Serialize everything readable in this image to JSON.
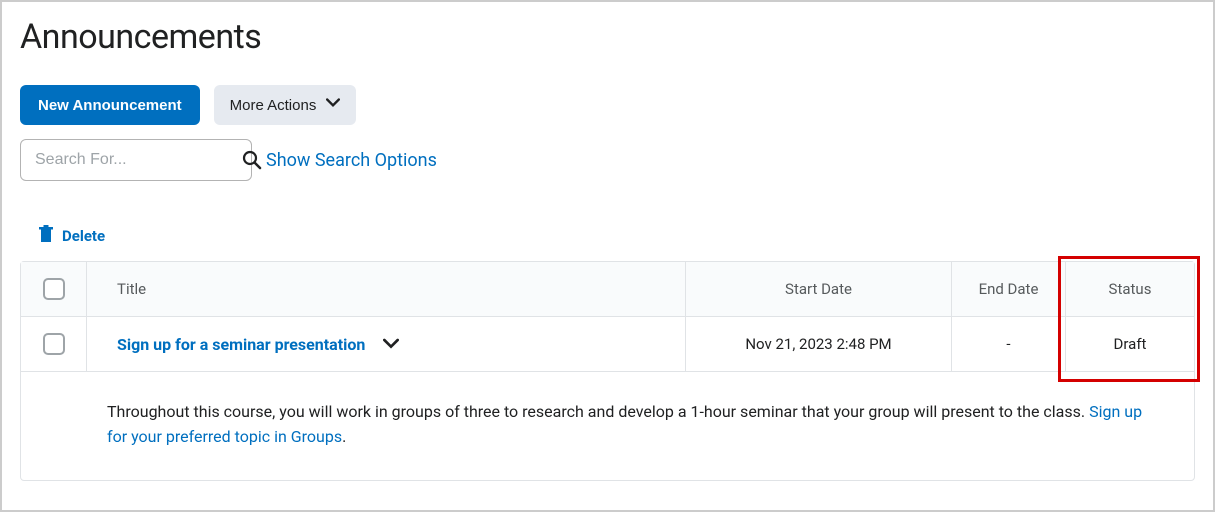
{
  "page": {
    "title": "Announcements"
  },
  "toolbar": {
    "new_announcement_label": "New Announcement",
    "more_actions_label": "More Actions"
  },
  "search": {
    "placeholder": "Search For...",
    "show_options_label": "Show Search Options"
  },
  "actions": {
    "delete_label": "Delete"
  },
  "table": {
    "headers": {
      "title": "Title",
      "start_date": "Start Date",
      "end_date": "End Date",
      "status": "Status"
    },
    "rows": [
      {
        "title": "Sign up for a seminar presentation",
        "start_date": "Nov 21, 2023 2:48 PM",
        "end_date": "-",
        "status": "Draft",
        "description_prefix": "Throughout this course, you will work in groups of three to research and develop a 1-hour seminar that your group will present to the class. ",
        "description_link": "Sign up for your preferred topic in Groups",
        "description_suffix": "."
      }
    ]
  },
  "highlight": {
    "visible": true
  }
}
